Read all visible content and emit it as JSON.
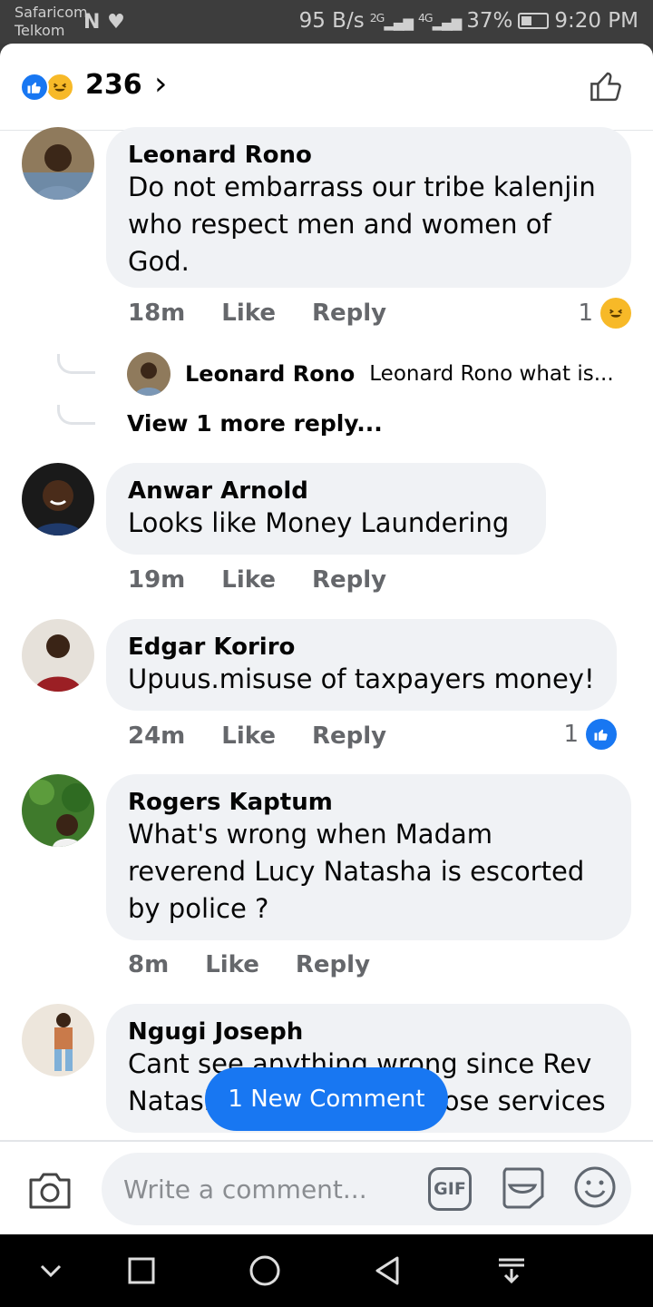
{
  "status_bar": {
    "carrier_1": "Safaricom",
    "carrier_2": "Telkom",
    "carrier_icons": "N ♥",
    "speed": "95 B/s",
    "sim1_label": "2G",
    "sim2_label": "4G",
    "battery": "37%",
    "time": "9:20 PM"
  },
  "header": {
    "reaction_total": "236",
    "reaction_types": [
      "like",
      "haha"
    ]
  },
  "comments": [
    {
      "author": "Leonard Rono",
      "text": "Do not embarrass our tribe kalenjin who respect men and women of God.",
      "time": "18m",
      "like_label": "Like",
      "reply_label": "Reply",
      "reaction_count": "1",
      "reaction_type": "haha"
    },
    {
      "author": "Anwar Arnold",
      "text": "Looks like Money Laundering",
      "time": "19m",
      "like_label": "Like",
      "reply_label": "Reply"
    },
    {
      "author": "Edgar Koriro",
      "text": "Upuus.misuse of taxpayers money!",
      "time": "24m",
      "like_label": "Like",
      "reply_label": "Reply",
      "reaction_count": "1",
      "reaction_type": "like"
    },
    {
      "author": "Rogers Kaptum",
      "text": "What's wrong when Madam reverend Lucy Natasha is escorted by police ?",
      "time": "8m",
      "like_label": "Like",
      "reply_label": "Reply"
    },
    {
      "author": "Ngugi Joseph",
      "text": "Cant see anything wrong since Rev Natasha is paying for those services"
    }
  ],
  "reply_preview": {
    "author": "Leonard Rono",
    "text": "Leonard Rono what is...",
    "view_more": "View 1 more reply..."
  },
  "new_comment_label": "1 New Comment",
  "composer": {
    "placeholder": "Write a comment...",
    "gif_label": "GIF"
  },
  "colors": {
    "accent": "#1877f2",
    "bubble": "#f0f2f5",
    "muted_text": "#65676b",
    "haha": "#f7b928"
  },
  "icons": {
    "camera": "camera-icon",
    "gif": "gif-icon",
    "sticker": "sticker-icon",
    "emoji": "emoji-icon",
    "like_outline": "thumbs-up-outline-icon",
    "nav": [
      "chevron-down-icon",
      "square-icon",
      "circle-icon",
      "back-triangle-icon",
      "download-tray-icon"
    ]
  }
}
